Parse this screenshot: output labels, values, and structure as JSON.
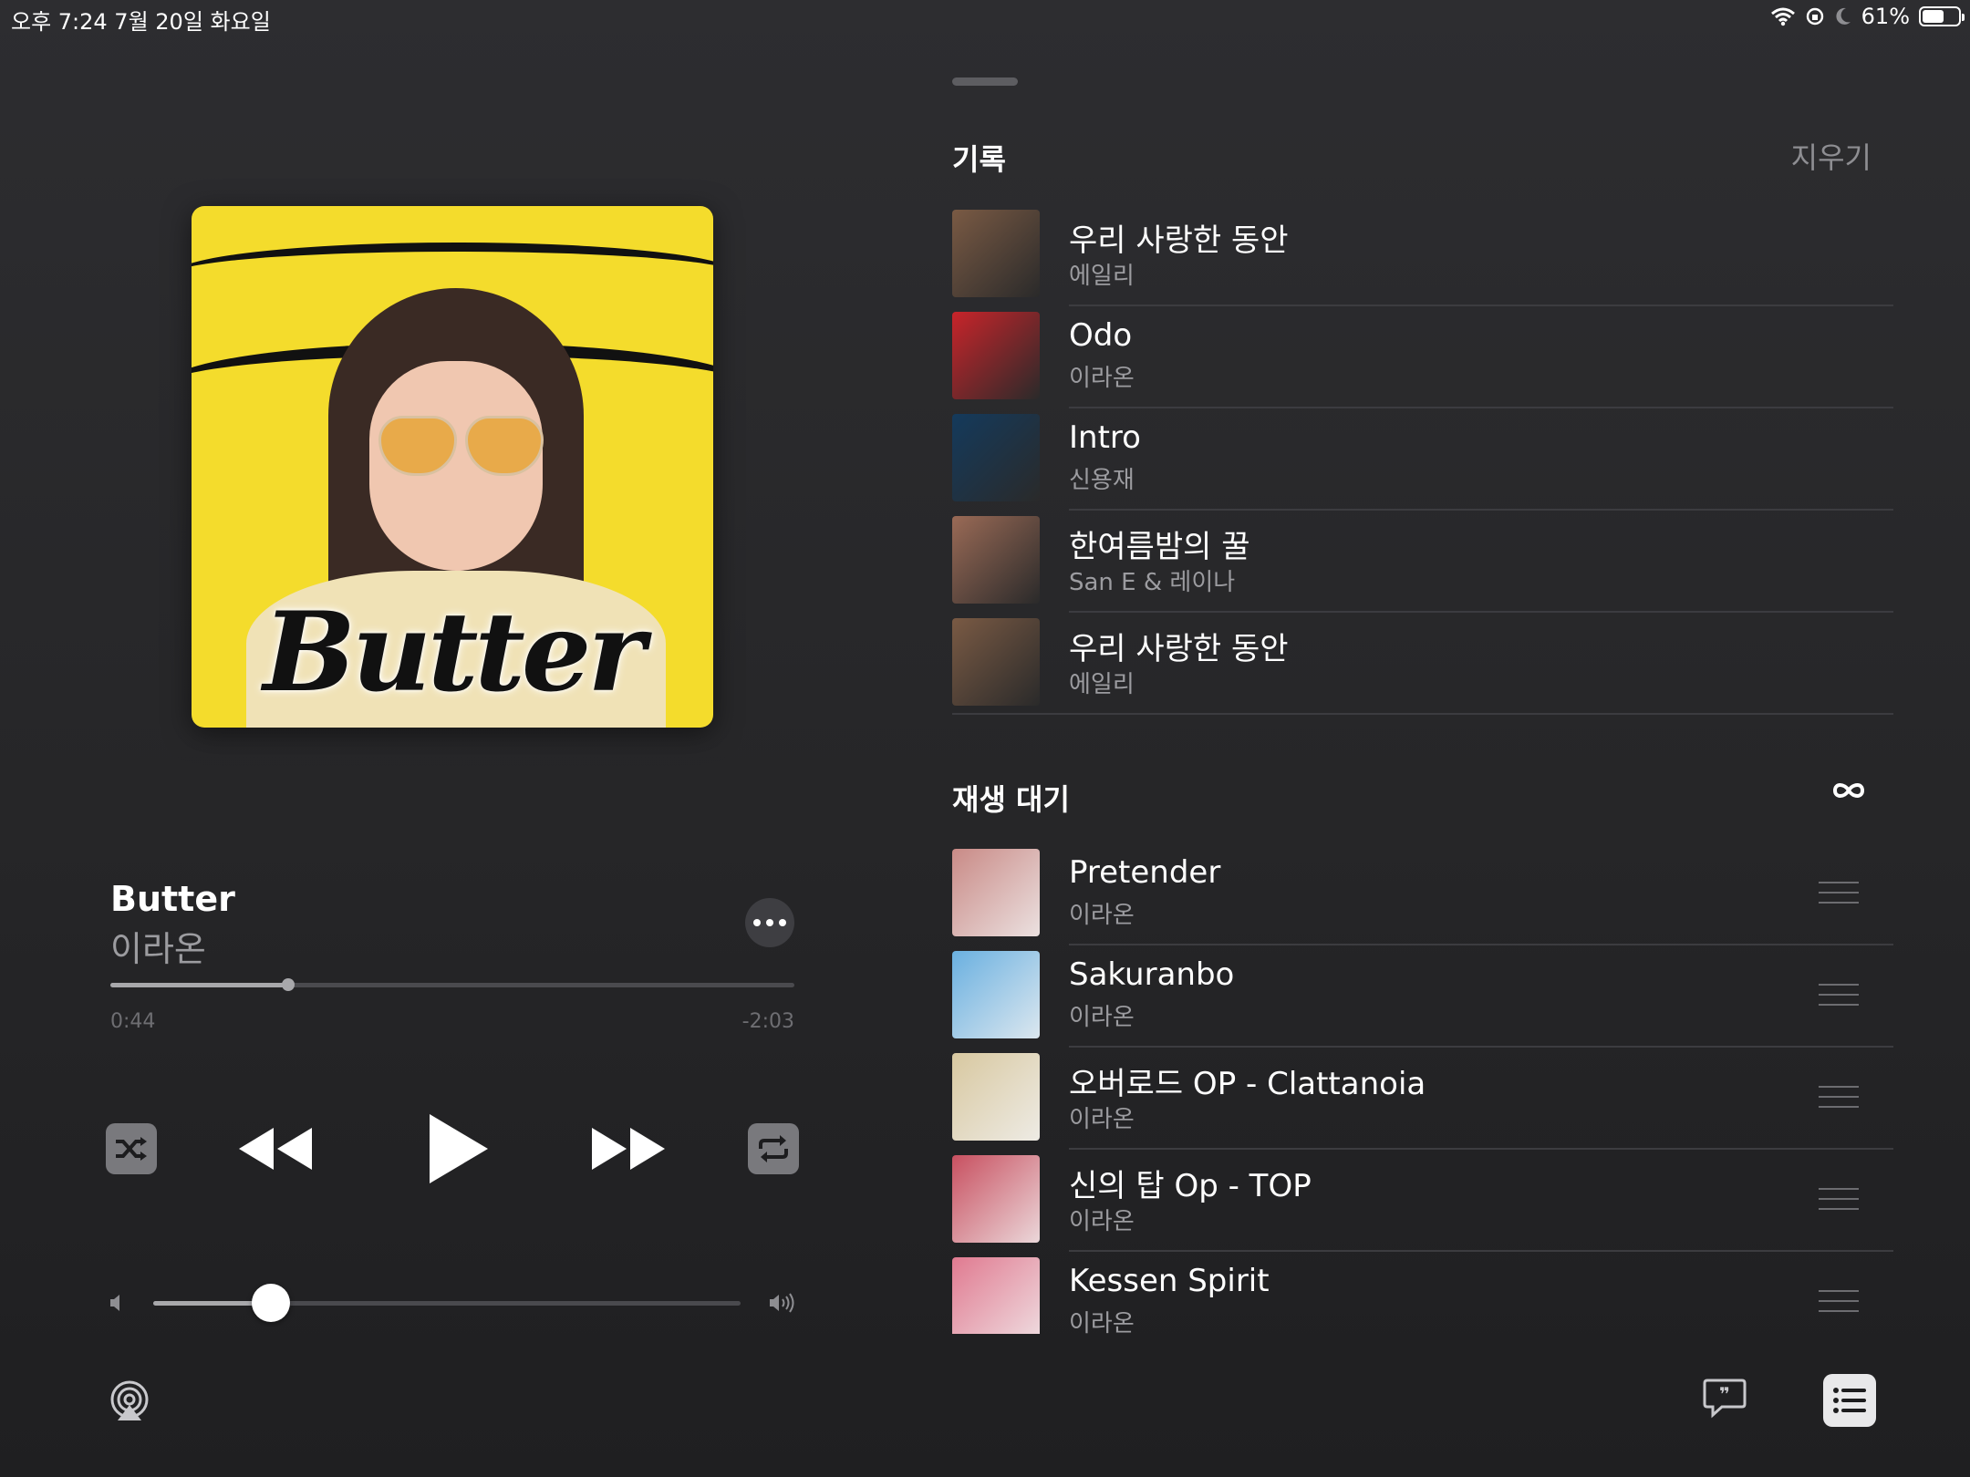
{
  "status": {
    "time": "오후 7:24   7월 20일 화요일",
    "battery": "61%",
    "battery_level": 0.61
  },
  "now_playing": {
    "artwork_title": "Butter",
    "title": "Butter",
    "artist": "이라온",
    "elapsed": "0:44",
    "remaining": "-2:03",
    "progress": 0.26,
    "volume": 0.2
  },
  "controls": {
    "shuffle_icon": "shuffle-icon",
    "previous_icon": "backward-icon",
    "play_icon": "play-icon",
    "next_icon": "forward-icon",
    "repeat_icon": "repeat-icon"
  },
  "history": {
    "title": "기록",
    "clear_label": "지우기",
    "items": [
      {
        "title": "우리 사랑한 동안",
        "artist": "에일리",
        "color": "#7a5a44"
      },
      {
        "title": "Odo",
        "artist": "이라온",
        "color": "#c8242a"
      },
      {
        "title": "Intro",
        "artist": "신용재",
        "color": "#143a5c"
      },
      {
        "title": "한여름밤의 꿀",
        "artist": "San E & 레이나",
        "color": "#9a6a56"
      },
      {
        "title": "우리 사랑한 동안",
        "artist": "에일리",
        "color": "#7a5a44"
      }
    ]
  },
  "up_next": {
    "title": "재생 대기",
    "items": [
      {
        "title": "Pretender",
        "artist": "이라온",
        "color": "#c98a86"
      },
      {
        "title": "Sakuranbo",
        "artist": "이라온",
        "color": "#6ab0e0"
      },
      {
        "title": "오버로드 OP - Clattanoia",
        "artist": "이라온",
        "color": "#d8c8a0"
      },
      {
        "title": "신의 탑 Op - TOP",
        "artist": "이라온",
        "color": "#c85060"
      },
      {
        "title": "Kessen Spirit",
        "artist": "이라온",
        "color": "#e07a90"
      }
    ]
  }
}
